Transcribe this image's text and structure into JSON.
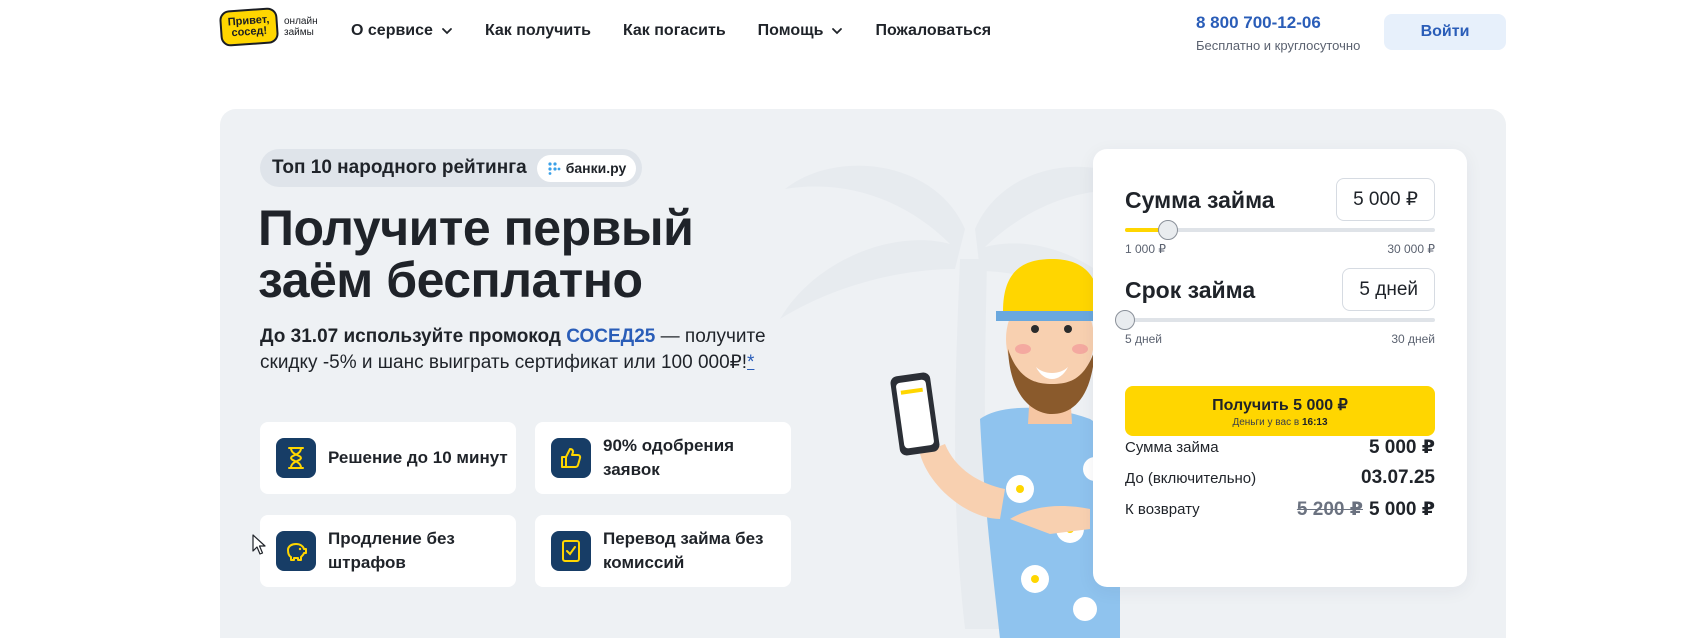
{
  "header": {
    "logo": {
      "main_line1": "Привет,",
      "main_line2": "сосед!",
      "side_line1": "онлайн",
      "side_line2": "займы"
    },
    "nav": [
      {
        "label": "О сервисе",
        "has_dropdown": true
      },
      {
        "label": "Как получить",
        "has_dropdown": false
      },
      {
        "label": "Как погасить",
        "has_dropdown": false
      },
      {
        "label": "Помощь",
        "has_dropdown": true
      },
      {
        "label": "Пожаловаться",
        "has_dropdown": false
      }
    ],
    "phone": "8 800 700-12-06",
    "phone_subtitle": "Бесплатно и круглосуточно",
    "login_label": "Войти"
  },
  "hero": {
    "rating_text": "Топ 10 народного рейтинга",
    "rating_partner": "банки.ру",
    "title_line1": "Получите первый",
    "title_line2": "заём бесплатно",
    "promo": {
      "prefix": "До 31.07 используйте промокод",
      "code": "СОСЕД25",
      "suffix": "— получите скидку -5% и шанс выиграть сертификат или 100 000₽!",
      "footnote": "*"
    },
    "features": [
      {
        "icon": "hourglass-icon",
        "text": "Решение до 10 минут"
      },
      {
        "icon": "thumbs-up-icon",
        "text": "90% одобрения заявок"
      },
      {
        "icon": "piggy-bank-icon",
        "text": "Продление без штрафов"
      },
      {
        "icon": "document-check-icon",
        "text": "Перевод займа без комиссий"
      }
    ]
  },
  "calculator": {
    "amount": {
      "label": "Сумма займа",
      "value": "5 000 ₽",
      "min_label": "1 000 ₽",
      "max_label": "30 000 ₽",
      "min": 1000,
      "max": 30000,
      "current": 5000
    },
    "term": {
      "label": "Срок займа",
      "value": "5 дней",
      "min_label": "5 дней",
      "max_label": "30 дней",
      "min": 5,
      "max": 30,
      "current": 5
    },
    "cta": {
      "label": "Получить 5 000 ₽",
      "sub_prefix": "Деньги у вас в",
      "sub_time": "16:13"
    },
    "summary": [
      {
        "label": "Сумма займа",
        "value": "5 000 ₽"
      },
      {
        "label": "До (включительно)",
        "value": "03.07.25"
      },
      {
        "label": "К возврату",
        "old_value": "5 200 ₽",
        "value": "5 000 ₽"
      }
    ]
  },
  "colors": {
    "accent_yellow": "#ffd600",
    "link_blue": "#2a5db8",
    "icon_navy": "#173d66",
    "hero_bg": "#eef1f4"
  }
}
